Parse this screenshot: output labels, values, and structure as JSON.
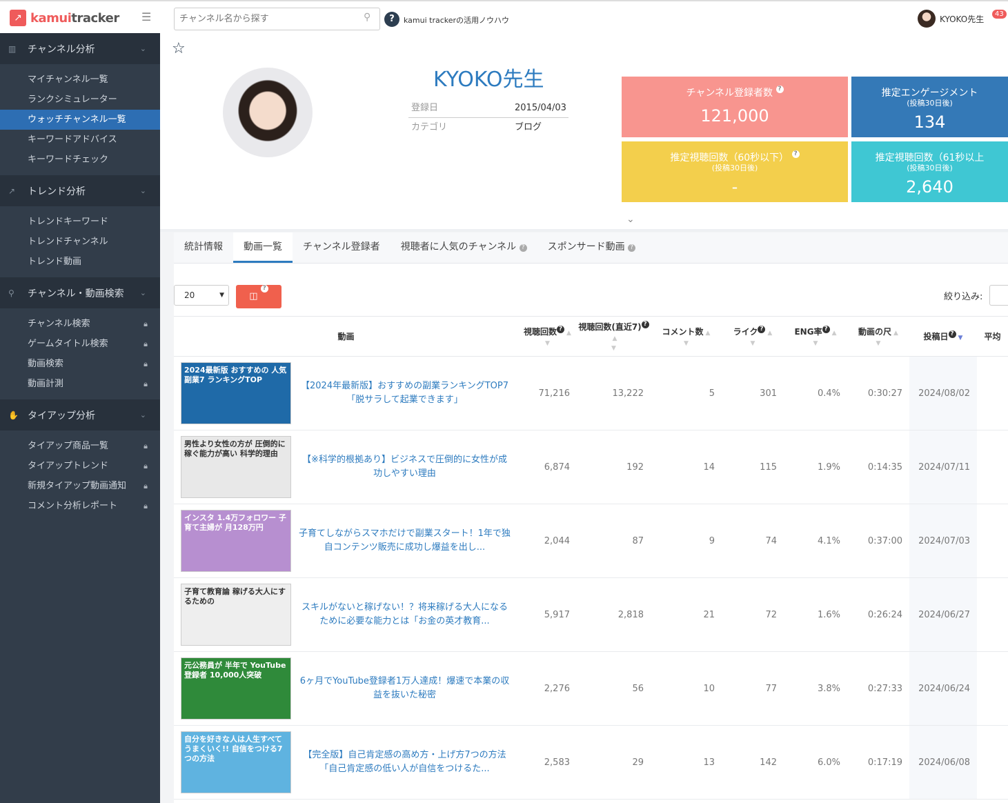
{
  "header": {
    "logo_prefix": "kamui",
    "logo_suffix": "tracker",
    "search_placeholder": "チャンネル名から探す",
    "help_link": "kamui trackerの活用ノウハウ",
    "user_name": "KYOKO先生",
    "notification_count": "43"
  },
  "sidebar": {
    "sections": [
      {
        "label": "チャンネル分析",
        "icon": "bar-chart-icon",
        "items": [
          {
            "label": "マイチャンネル一覧"
          },
          {
            "label": "ランクシミュレーター"
          },
          {
            "label": "ウォッチチャンネル一覧",
            "active": true
          },
          {
            "label": "キーワードアドバイス"
          },
          {
            "label": "キーワードチェック"
          }
        ]
      },
      {
        "label": "トレンド分析",
        "icon": "trend-icon",
        "items": [
          {
            "label": "トレンドキーワード"
          },
          {
            "label": "トレンドチャンネル"
          },
          {
            "label": "トレンド動画"
          }
        ]
      },
      {
        "label": "チャンネル・動画検索",
        "icon": "search-icon",
        "items": [
          {
            "label": "チャンネル検索",
            "locked": true
          },
          {
            "label": "ゲームタイトル検索",
            "locked": true
          },
          {
            "label": "動画検索",
            "locked": true
          },
          {
            "label": "動画計測",
            "locked": true
          }
        ]
      },
      {
        "label": "タイアップ分析",
        "icon": "handshake-icon",
        "items": [
          {
            "label": "タイアップ商品一覧",
            "locked": true
          },
          {
            "label": "タイアップトレンド",
            "locked": true
          },
          {
            "label": "新規タイアップ動画通知",
            "locked": true
          },
          {
            "label": "コメント分析レポート",
            "locked": true
          }
        ]
      }
    ]
  },
  "channel": {
    "name": "KYOKO先生",
    "registered_label": "登録日",
    "registered": "2015/04/03",
    "category_label": "カテゴリ",
    "category": "ブログ"
  },
  "cards": [
    {
      "title": "チャンネル登録者数",
      "sub": "",
      "value": "121,000",
      "color": "#f8958f"
    },
    {
      "title": "推定エンゲージメント",
      "sub": "(投稿30日後)",
      "value": "134",
      "color": "#3479b7"
    },
    {
      "title": "推定視聴回数（60秒以下）",
      "sub": "(投稿30日後)",
      "value": "-",
      "color": "#f3cf4c"
    },
    {
      "title": "推定視聴回数（61秒以上",
      "sub": "(投稿30日後)",
      "value": "2,640",
      "color": "#3fc7d3"
    }
  ],
  "tabs": [
    "統計情報",
    "動画一覧",
    "チャンネル登録者",
    "視聴者に人気のチャンネル",
    "スポンサード動画"
  ],
  "controls": {
    "page_size": "20",
    "filter_label": "絞り込み:"
  },
  "table": {
    "headers": [
      "動画",
      "視聴回数",
      "視聴回数(直近7)",
      "コメント数",
      "ライク",
      "ENG率",
      "動画の尺",
      "投稿日",
      "平均"
    ],
    "rows": [
      {
        "thumb": "2024最新版 おすすめの 人気副業7 ランキングTOP",
        "thumb_color": "#1f6aa8",
        "title": "【2024年最新版】おすすめの副業ランキングTOP7「脱サラして起業できます」",
        "views": "71,216",
        "recent7": "13,222",
        "comments": "5",
        "likes": "301",
        "eng": "0.4%",
        "duration": "0:30:27",
        "date": "2024/08/02"
      },
      {
        "thumb": "男性より女性の方が 圧倒的に 稼ぐ能力が高い 科学的理由",
        "thumb_color": "#e8e8e8",
        "title": "【※科学的根拠あり】ビジネスで圧倒的に女性が成功しやすい理由",
        "views": "6,874",
        "recent7": "192",
        "comments": "14",
        "likes": "115",
        "eng": "1.9%",
        "duration": "0:14:35",
        "date": "2024/07/11"
      },
      {
        "thumb": "インスタ 1.4万フォロワー 子育て主婦が 月128万円",
        "thumb_color": "#b78fd0",
        "title": "子育てしながらスマホだけで副業スタート！1年で独自コンテンツ販売に成功し爆益を出し...",
        "views": "2,044",
        "recent7": "87",
        "comments": "9",
        "likes": "74",
        "eng": "4.1%",
        "duration": "0:37:00",
        "date": "2024/07/03"
      },
      {
        "thumb": "子育て教育論 稼げる大人にするための",
        "thumb_color": "#eeeeee",
        "title": "スキルがないと稼げない！？将来稼げる大人になるために必要な能力とは「お金の英才教育...",
        "views": "5,917",
        "recent7": "2,818",
        "comments": "21",
        "likes": "72",
        "eng": "1.6%",
        "duration": "0:26:24",
        "date": "2024/06/27"
      },
      {
        "thumb": "元公務員が 半年で YouTube登録者 10,000人突破",
        "thumb_color": "#2f8a3a",
        "title": "6ヶ月でYouTube登録者1万人達成！爆速で本業の収益を抜いた秘密",
        "views": "2,276",
        "recent7": "56",
        "comments": "10",
        "likes": "77",
        "eng": "3.8%",
        "duration": "0:27:33",
        "date": "2024/06/24"
      },
      {
        "thumb": "自分を好きな人は人生すべてうまくいく!! 自信をつける7つの方法",
        "thumb_color": "#5fb3e0",
        "title": "【完全版】自己肯定感の高め方・上げ方7つの方法「自己肯定感の低い人が自信をつけるた...",
        "views": "2,583",
        "recent7": "29",
        "comments": "13",
        "likes": "142",
        "eng": "6.0%",
        "duration": "0:17:19",
        "date": "2024/06/08"
      }
    ]
  }
}
